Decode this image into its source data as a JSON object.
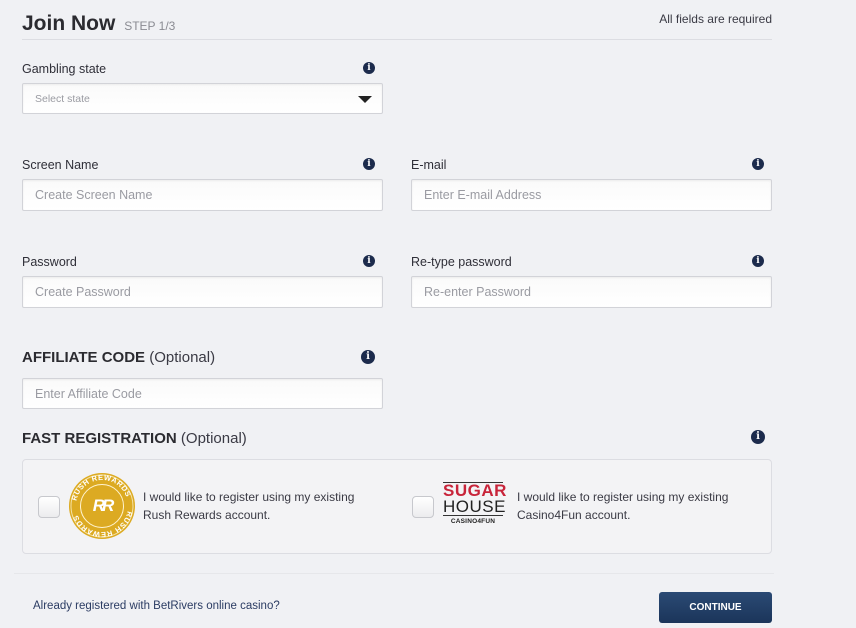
{
  "header": {
    "title": "Join Now",
    "step": "STEP 1/3",
    "required_note": "All fields are required"
  },
  "gambling_state": {
    "label": "Gambling state",
    "selected": "Select state"
  },
  "screen_name": {
    "label": "Screen Name",
    "placeholder": "Create Screen Name",
    "value": ""
  },
  "email": {
    "label": "E-mail",
    "placeholder": "Enter E-mail Address",
    "value": ""
  },
  "password": {
    "label": "Password",
    "placeholder": "Create Password",
    "value": ""
  },
  "retype_password": {
    "label": "Re-type password",
    "placeholder": "Re-enter Password",
    "value": ""
  },
  "affiliate": {
    "label": "AFFILIATE CODE",
    "optional": "(Optional)",
    "placeholder": "Enter Affiliate Code",
    "value": ""
  },
  "fast_registration": {
    "label": "FAST REGISTRATION",
    "optional": "(Optional)",
    "options": [
      {
        "logo": "rush-rewards-logo",
        "logo_text": "RR",
        "logo_ring_text": "RUSH REWARDS",
        "text_line1": "I would like to register using my existing",
        "text_line2": "Rush Rewards account.",
        "checked": false
      },
      {
        "logo": "sugarhouse-logo",
        "logo_line1": "SUGAR",
        "logo_line2": "HOUSE",
        "logo_sub": "CASINO4FUN",
        "text_line1": "I would like to register using my existing",
        "text_line2": "Casino4Fun account.",
        "checked": false
      }
    ]
  },
  "footer": {
    "already_registered": "Already registered with BetRivers online casino?",
    "continue_label": "CONTINUE"
  },
  "icons": {
    "info": "i"
  },
  "colors": {
    "background": "#f0f1f4",
    "info_icon": "#1c2b4c",
    "button": "#1f3b63",
    "rush_gold": "#dcaa22",
    "sugar_red": "#c8243a"
  }
}
